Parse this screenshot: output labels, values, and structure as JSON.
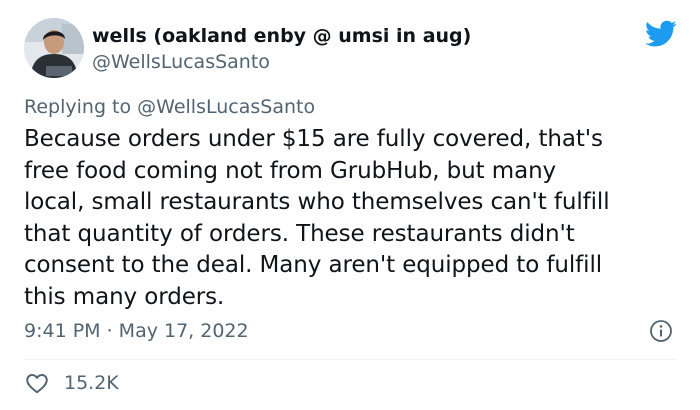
{
  "author": {
    "display_name": "wells (oakland enby @ umsi in aug)",
    "handle": "@WellsLucasSanto"
  },
  "reply": {
    "prefix": "Replying to ",
    "handle": "@WellsLucasSanto"
  },
  "tweet": {
    "lines": [
      "Because orders under $15 are fully covered, that's",
      "free food coming not from GrubHub, but many",
      "local, small restaurants who themselves can't fulfill",
      "that quantity of orders. These restaurants didn't",
      "consent to the deal. Many aren't equipped to fulfill",
      "this many orders."
    ],
    "timestamp": "9:41 PM · May 17, 2022"
  },
  "engagement": {
    "likes": "15.2K"
  },
  "icons": {
    "logo": "twitter-bird-icon",
    "info": "info-icon",
    "like": "heart-icon"
  },
  "colors": {
    "brand": "#1d9bf0",
    "text": "#0f1419",
    "secondary": "#536471",
    "divider": "#eff3f4"
  }
}
